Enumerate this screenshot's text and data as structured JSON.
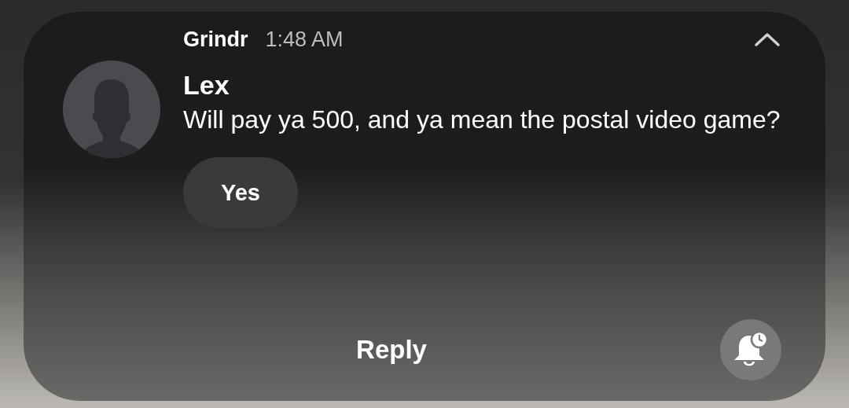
{
  "notification": {
    "app": "Grindr",
    "time": "1:48 AM",
    "expanded": true,
    "sender": "Lex",
    "message": "Will pay ya 500, and ya mean the postal video game?",
    "quick_replies": [
      "Yes"
    ],
    "reply_label": "Reply"
  }
}
